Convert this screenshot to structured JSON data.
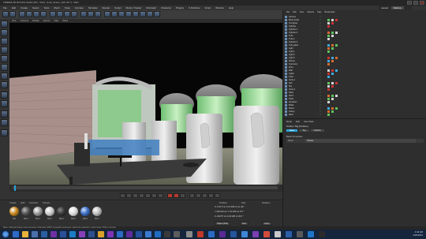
{
  "window": {
    "title": "CINEMA 4D R14.014 Studio (RC - R14) - [Lab_Scene_v18.c4d *] - Main"
  },
  "menubar": {
    "items": [
      "File",
      "Edit",
      "Create",
      "Select",
      "Tools",
      "Mesh",
      "Snap",
      "Animate",
      "Simulate",
      "Render",
      "Sculpt",
      "Motion Tracker",
      "MoGraph",
      "Character",
      "Plugins",
      "X-Particles",
      "Script",
      "Window",
      "Help"
    ],
    "layout_label": "Layout:",
    "layout_value": "Startup"
  },
  "viewport": {
    "menu": [
      "View",
      "Cameras",
      "Display",
      "Options",
      "Filter",
      "Panel"
    ]
  },
  "materials": {
    "menu": [
      "Create",
      "Edit",
      "Function",
      "Texture"
    ],
    "items": [
      {
        "name": "Mat",
        "color": "#c8881e"
      },
      {
        "name": "Mat.1",
        "color": "#555555"
      },
      {
        "name": "Mat.2",
        "color": "#9a9a9a"
      },
      {
        "name": "Mat.3",
        "color": "#cccccc"
      },
      {
        "name": "Mat.4",
        "color": "#3a3a3a"
      },
      {
        "name": "Mat.5",
        "color": "#dddddd"
      },
      {
        "name": "Mat.6",
        "color": "#3f6fc4"
      },
      {
        "name": "Mat.7",
        "color": "#bdbdbd"
      }
    ]
  },
  "coords": {
    "position_label": "Position",
    "size_label": "Size",
    "rotation_label": "Rotation",
    "rows": [
      "X  -6.377 cm   X  14 330 cm   H  -90 °",
      "Y  230.221 cm  Y  16 245 cm   P  0 °",
      "Z  -233.57 cm  Z  20 025 cm   B  0 °"
    ],
    "mode": "Object (Rel)",
    "size_mode": "Size",
    "apply_label": "Apply"
  },
  "objects": {
    "menu": [
      "File",
      "Edit",
      "View",
      "Objects",
      "Tags",
      "Bookmarks"
    ],
    "rows": [
      "Camera",
      "Boole bottle",
      "Test glass",
      "Cylinder",
      "Cylinder.1",
      "Cylinder.2",
      "Tube",
      "Tube.1",
      "Cylinder.3",
      "Tube glass",
      "Light",
      "Light.1",
      "Light.2",
      "Light.3",
      "Sphere",
      "Symmetry",
      "Floor",
      "Wall",
      "Lights",
      "Cube",
      "Cube.1",
      "Null",
      "Sky",
      "Cube.2",
      "Table",
      "Null.1",
      "Scale",
      "Aquarium",
      "Bottle",
      "Stand",
      "Clamp",
      "Rack"
    ]
  },
  "attributes": {
    "menu": [
      "Mode",
      "Edit",
      "User Data"
    ],
    "title": "Octane Tag [Octane]",
    "tabs": [
      "Basic",
      "Tag",
      "Visibility"
    ],
    "section": "Basic Properties",
    "name_label": "Name",
    "name_value": "Octane"
  },
  "status": {
    "text": "Move: Click and drag to move elements. Hold down SHIFT to quantize movement / add to the selection in point mode, CTRL to remove."
  },
  "clock": {
    "time": "4:42 AM",
    "date": "2/26/2013"
  }
}
